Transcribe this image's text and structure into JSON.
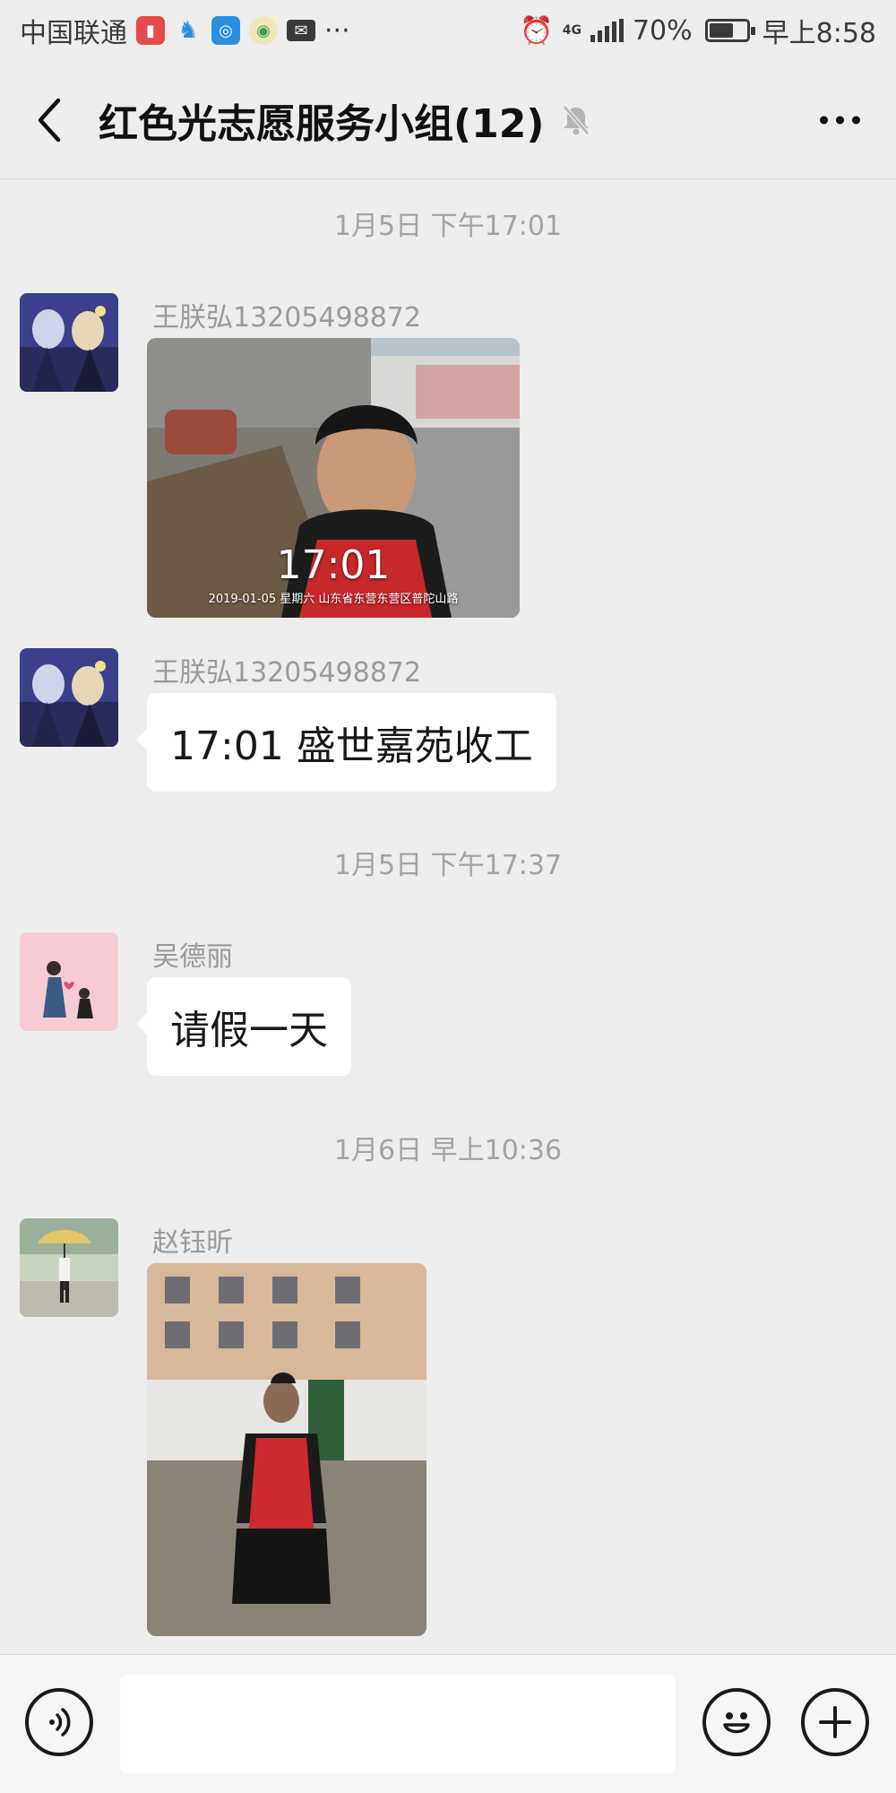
{
  "status_bar": {
    "carrier": "中国联通",
    "battery_percent": "70%",
    "battery_level": 0.7,
    "time": "早上8:58",
    "more": "···",
    "network": "4G",
    "icons": [
      "book-app-icon",
      "qq-icon",
      "browser-icon",
      "green-app-icon",
      "mail-icon",
      "alarm-icon",
      "signal-icon",
      "battery-icon"
    ]
  },
  "header": {
    "title": "红色光志愿服务小组(12)",
    "icons": [
      "back-arrow-icon",
      "mute-bell-icon",
      "more-dots-icon"
    ]
  },
  "chat": {
    "timestamps": [
      "1月5日 下午17:01",
      "1月5日 下午17:37",
      "1月6日 早上10:36"
    ],
    "messages": [
      {
        "sender": "王朕弘13205498872",
        "type": "image",
        "caption_time": "17:01",
        "caption_info": "2019-01-05 星期六  山东省东营东营区普陀山路"
      },
      {
        "sender": "王朕弘13205498872",
        "type": "text",
        "text": "17:01 盛世嘉苑收工"
      },
      {
        "sender": "吴德丽",
        "type": "text",
        "text": "请假一天"
      },
      {
        "sender": "赵钰昕",
        "type": "image"
      }
    ]
  },
  "input_bar": {
    "placeholder": "",
    "icons": [
      "voice-icon",
      "emoji-icon",
      "plus-icon"
    ]
  },
  "colors": {
    "background": "#ededed",
    "bubble": "#ffffff",
    "timestamp_text": "#a3a3a3",
    "sender_text": "#9a9a9a"
  }
}
